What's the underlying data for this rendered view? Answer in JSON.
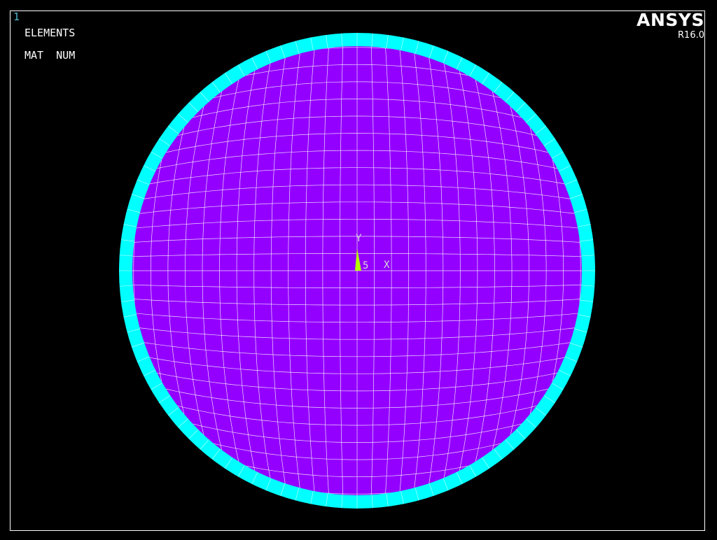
{
  "window": {
    "number": "1"
  },
  "legend": {
    "title": "ELEMENTS",
    "subtitle": "MAT  NUM"
  },
  "branding": {
    "name": "ANSYS",
    "version": "R16.0"
  },
  "triad": {
    "y_label": "Y",
    "x_label": "X",
    "center_label": "5"
  },
  "colors": {
    "background": "#000000",
    "frame": "#ffffff",
    "window_number": "#4fb7c9",
    "text": "#ffffff",
    "inner_material": "#9400ff",
    "outer_ring_material": "#00ffff",
    "mesh_lines": "#ffffff",
    "triad": "#b4ff00",
    "triad_text": "#d8d8d8"
  }
}
